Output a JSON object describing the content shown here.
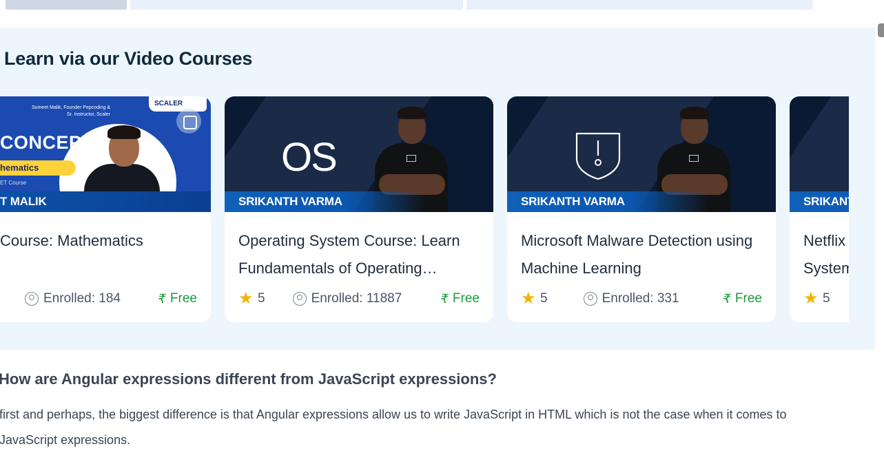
{
  "section": {
    "title": "Learn via our Video Courses"
  },
  "cards": [
    {
      "instructor": "T MALIK",
      "title": "Course: Mathematics",
      "rating": "",
      "enrolled": "Enrolled: 184",
      "price": "Free",
      "thumb": {
        "big_text": "CONCEPTS",
        "pill_text": "hematics",
        "small_text": "ET Course",
        "credit": "Sumeet Malik, Founder Pepcoding & Sr. Instructor, Scaler",
        "badge": "SCALER"
      }
    },
    {
      "instructor": "SRIKANTH VARMA",
      "title": "Operating System Course: Learn Fundamentals of Operating…",
      "rating": "5",
      "enrolled": "Enrolled: 11887",
      "price": "Free",
      "thumb": {
        "big_text": "OS"
      }
    },
    {
      "instructor": "SRIKANTH VARMA",
      "title": "Microsoft Malware Detection using Machine Learning",
      "rating": "5",
      "enrolled": "Enrolled: 331",
      "price": "Free",
      "thumb": {
        "icon": "shield-alert-icon"
      }
    },
    {
      "instructor": "SRIKANT",
      "title": "Netflix System",
      "rating": "5",
      "enrolled": "",
      "price": ""
    }
  ],
  "article": {
    "heading": "How are Angular expressions different from JavaScript expressions?",
    "paragraph": "first and perhaps, the biggest difference is that Angular expressions allow us to write JavaScript in HTML which is not the case when it comes to JavaScript expressions."
  },
  "colors": {
    "section_bg": "#eef6fd",
    "instructor_bar": "#0b57b0",
    "free_green": "#1a9a3a",
    "star_yellow": "#f0b400"
  }
}
